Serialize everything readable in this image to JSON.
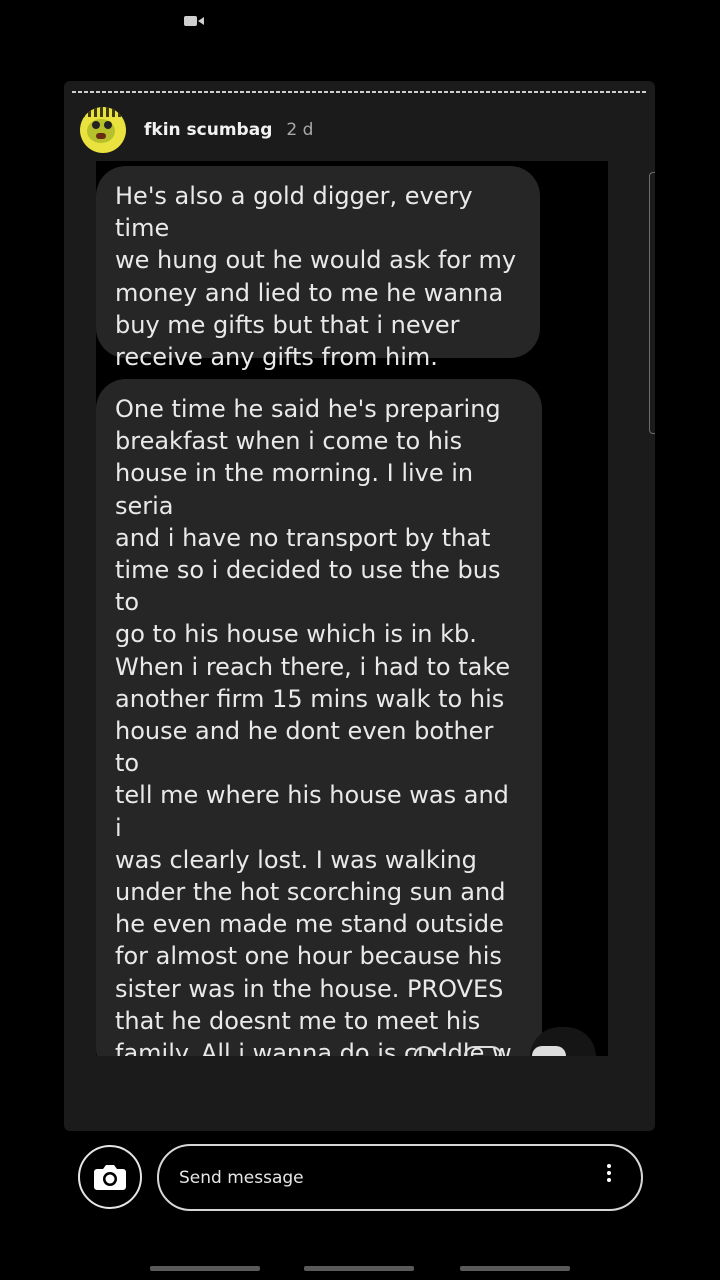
{
  "status_bar": {
    "icon": "video-camera-icon"
  },
  "story": {
    "username": "fkin scumbag",
    "timestamp": "2 d",
    "avatar_icon": "avatar-icon",
    "messages": [
      {
        "text": "He's also a gold digger, every time\nwe hung out he would ask for my\nmoney and lied to me he wanna\nbuy me gifts but that i never\nreceive any gifts from him."
      },
      {
        "text": "One time he said he's preparing\nbreakfast when i come to his\nhouse in the morning. I live in seria\nand i have no transport by that\ntime so i decided to use the bus to\ngo to his house which is in kb.\nWhen i reach there, i had to take\nanother firm 15 mins walk to his\nhouse and he dont even bother to\ntell me where his house was and i\nwas clearly lost. I was walking\nunder the hot scorching sun and\nhe even made me stand outside\nfor almost one hour because his\nsister was in the house. PROVES\nthat he doesnt me to meet his\nfamily. All i wanna do is cuddle w\nhim but he decided to do\nsomething else AND I WAS ON MY\nPERIOD"
      }
    ]
  },
  "footer": {
    "camera_icon": "camera-icon",
    "message_placeholder": "Send message",
    "more_icon": "more-vertical-icon"
  },
  "colors": {
    "background": "#000000",
    "card": "#1b1b1b",
    "bubble": "#262626",
    "text": "#e9e9e9"
  }
}
